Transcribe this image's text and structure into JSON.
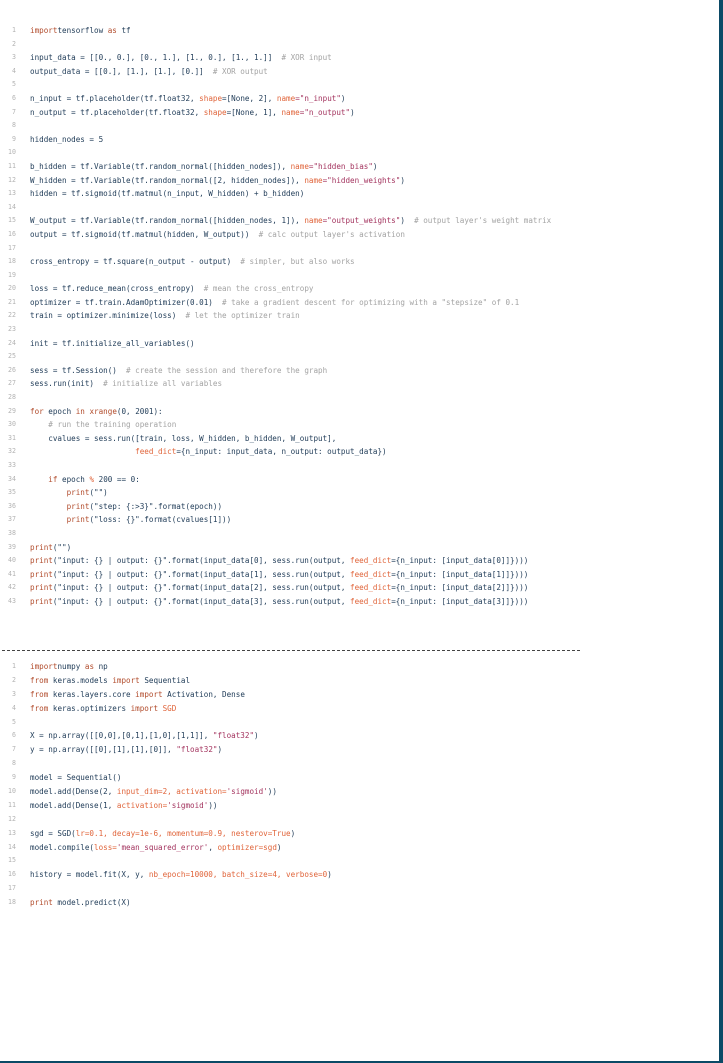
{
  "snippet_tensorflow": {
    "lines": [
      {
        "n": "1",
        "t": [
          [
            "kw",
            "import"
          ],
          [
            "",
            "tensorflow "
          ],
          [
            "kw",
            "as"
          ],
          [
            "",
            " tf"
          ]
        ]
      },
      {
        "n": "2",
        "t": []
      },
      {
        "n": "3",
        "t": [
          [
            "",
            "input_data = [[0., 0.], [0., 1.], [1., 0.], [1., 1.]]  "
          ],
          [
            "com",
            "# XOR input"
          ]
        ]
      },
      {
        "n": "4",
        "t": [
          [
            "",
            "output_data = [[0.], [1.], [1.], [0.]]  "
          ],
          [
            "com",
            "# XOR output"
          ]
        ]
      },
      {
        "n": "5",
        "t": []
      },
      {
        "n": "6",
        "t": [
          [
            "",
            "n_input = tf.placeholder(tf.float32, "
          ],
          [
            "prm",
            "shape"
          ],
          [
            "",
            "=[None, 2], "
          ],
          [
            "prm",
            "name"
          ],
          [
            "str",
            "=\"n_input\""
          ],
          [
            "",
            ")"
          ]
        ]
      },
      {
        "n": "7",
        "t": [
          [
            "",
            "n_output = tf.placeholder(tf.float32, "
          ],
          [
            "prm",
            "shape"
          ],
          [
            "",
            "=[None, 1], "
          ],
          [
            "prm",
            "name"
          ],
          [
            "str",
            "=\"n_output\""
          ],
          [
            "",
            ")"
          ]
        ]
      },
      {
        "n": "8",
        "t": []
      },
      {
        "n": "9",
        "t": [
          [
            "",
            "hidden_nodes = 5"
          ]
        ]
      },
      {
        "n": "10",
        "t": []
      },
      {
        "n": "11",
        "t": [
          [
            "",
            "b_hidden = tf.Variable(tf.random_normal([hidden_nodes]), "
          ],
          [
            "prm",
            "name"
          ],
          [
            "str",
            "=\"hidden_bias\""
          ],
          [
            "",
            ")"
          ]
        ]
      },
      {
        "n": "12",
        "t": [
          [
            "",
            "W_hidden = tf.Variable(tf.random_normal([2, hidden_nodes]), "
          ],
          [
            "prm",
            "name"
          ],
          [
            "str",
            "=\"hidden_weights\""
          ],
          [
            "",
            ")"
          ]
        ]
      },
      {
        "n": "13",
        "t": [
          [
            "",
            "hidden = tf.sigmoid(tf.matmul(n_input, W_hidden) + b_hidden)"
          ]
        ]
      },
      {
        "n": "14",
        "t": []
      },
      {
        "n": "15",
        "t": [
          [
            "",
            "W_output = tf.Variable(tf.random_normal([hidden_nodes, 1]), "
          ],
          [
            "prm",
            "name"
          ],
          [
            "str",
            "=\"output_weights\""
          ],
          [
            "",
            ")  "
          ],
          [
            "com",
            "# output layer's weight matrix"
          ]
        ]
      },
      {
        "n": "16",
        "t": [
          [
            "",
            "output = tf.sigmoid(tf.matmul(hidden, W_output))  "
          ],
          [
            "com",
            "# calc output layer's activation"
          ]
        ]
      },
      {
        "n": "17",
        "t": []
      },
      {
        "n": "18",
        "t": [
          [
            "",
            "cross_entropy = tf.square(n_output - output)  "
          ],
          [
            "com",
            "# simpler, but also works"
          ]
        ]
      },
      {
        "n": "19",
        "t": []
      },
      {
        "n": "20",
        "t": [
          [
            "",
            "loss = tf.reduce_mean(cross_entropy)  "
          ],
          [
            "com",
            "# mean the cross_entropy"
          ]
        ]
      },
      {
        "n": "21",
        "t": [
          [
            "",
            "optimizer = tf.train.AdamOptimizer(0.01)  "
          ],
          [
            "com",
            "# take a gradient descent for optimizing with a \"stepsize\" of 0.1"
          ]
        ]
      },
      {
        "n": "22",
        "t": [
          [
            "",
            "train = optimizer.minimize(loss)  "
          ],
          [
            "com",
            "# let the optimizer train"
          ]
        ]
      },
      {
        "n": "23",
        "t": []
      },
      {
        "n": "24",
        "t": [
          [
            "",
            "init = tf.initialize_all_variables()"
          ]
        ]
      },
      {
        "n": "25",
        "t": []
      },
      {
        "n": "26",
        "t": [
          [
            "",
            "sess = tf.Session()  "
          ],
          [
            "com",
            "# create the session and therefore the graph"
          ]
        ]
      },
      {
        "n": "27",
        "t": [
          [
            "",
            "sess.run(init)  "
          ],
          [
            "com",
            "# initialize all variables"
          ]
        ]
      },
      {
        "n": "28",
        "t": []
      },
      {
        "n": "29",
        "t": [
          [
            "kw",
            "for"
          ],
          [
            "",
            " epoch "
          ],
          [
            "kw",
            "in"
          ],
          [
            "",
            " "
          ],
          [
            "bi",
            "xrange"
          ],
          [
            "",
            "(0, 2001):"
          ]
        ]
      },
      {
        "n": "30",
        "t": [
          [
            "",
            "    "
          ],
          [
            "com",
            "# run the training operation"
          ]
        ]
      },
      {
        "n": "31",
        "t": [
          [
            "",
            "    cvalues = sess.run([train, loss, W_hidden, b_hidden, W_output],"
          ]
        ]
      },
      {
        "n": "32",
        "t": [
          [
            "",
            "                       "
          ],
          [
            "prm",
            "feed_dict"
          ],
          [
            "",
            "={n_input: input_data, n_output: output_data})"
          ]
        ]
      },
      {
        "n": "33",
        "t": []
      },
      {
        "n": "34",
        "t": [
          [
            "",
            "    "
          ],
          [
            "kw",
            "if"
          ],
          [
            "",
            " epoch "
          ],
          [
            "prm",
            "%"
          ],
          [
            "",
            " 200 == 0:"
          ]
        ]
      },
      {
        "n": "35",
        "t": [
          [
            "",
            "        "
          ],
          [
            "bi",
            "print"
          ],
          [
            "",
            "(\"\")"
          ]
        ]
      },
      {
        "n": "36",
        "t": [
          [
            "",
            "        "
          ],
          [
            "bi",
            "print"
          ],
          [
            "",
            "(\"step: {:>3}\".format(epoch))"
          ]
        ]
      },
      {
        "n": "37",
        "t": [
          [
            "",
            "        "
          ],
          [
            "bi",
            "print"
          ],
          [
            "",
            "(\"loss: {}\".format(cvalues[1]))"
          ]
        ]
      },
      {
        "n": "38",
        "t": []
      },
      {
        "n": "39",
        "t": [
          [
            "bi",
            "print"
          ],
          [
            "",
            "(\"\")"
          ]
        ]
      },
      {
        "n": "40",
        "t": [
          [
            "bi",
            "print"
          ],
          [
            "",
            "(\"input: {} | output: {}\".format(input_data[0], sess.run(output, "
          ],
          [
            "prm",
            "feed_dict"
          ],
          [
            "",
            "={n_input: [input_data[0]]})))"
          ]
        ]
      },
      {
        "n": "41",
        "t": [
          [
            "bi",
            "print"
          ],
          [
            "",
            "(\"input: {} | output: {}\".format(input_data[1], sess.run(output, "
          ],
          [
            "prm",
            "feed_dict"
          ],
          [
            "",
            "={n_input: [input_data[1]]})))"
          ]
        ]
      },
      {
        "n": "42",
        "t": [
          [
            "bi",
            "print"
          ],
          [
            "",
            "(\"input: {} | output: {}\".format(input_data[2], sess.run(output, "
          ],
          [
            "prm",
            "feed_dict"
          ],
          [
            "",
            "={n_input: [input_data[2]]})))"
          ]
        ]
      },
      {
        "n": "43",
        "t": [
          [
            "bi",
            "print"
          ],
          [
            "",
            "(\"input: {} | output: {}\".format(input_data[3], sess.run(output, "
          ],
          [
            "prm",
            "feed_dict"
          ],
          [
            "",
            "={n_input: [input_data[3]]})))"
          ]
        ]
      }
    ]
  },
  "snippet_keras": {
    "lines": [
      {
        "n": "1",
        "t": [
          [
            "kw",
            "import"
          ],
          [
            "",
            "numpy "
          ],
          [
            "kw",
            "as"
          ],
          [
            "",
            " np"
          ]
        ]
      },
      {
        "n": "2",
        "t": [
          [
            "kw",
            "from"
          ],
          [
            "",
            " keras.models "
          ],
          [
            "kw",
            "import"
          ],
          [
            "",
            " Sequential"
          ]
        ]
      },
      {
        "n": "3",
        "t": [
          [
            "kw",
            "from"
          ],
          [
            "",
            " keras.layers.core "
          ],
          [
            "kw",
            "import"
          ],
          [
            "",
            " Activation, Dense"
          ]
        ]
      },
      {
        "n": "4",
        "t": [
          [
            "kw",
            "from"
          ],
          [
            "",
            " keras.optimizers "
          ],
          [
            "kw",
            "import"
          ],
          [
            "",
            " "
          ],
          [
            "prm",
            "SGD"
          ]
        ]
      },
      {
        "n": "5",
        "t": []
      },
      {
        "n": "6",
        "t": [
          [
            "",
            "X = np.array([[0,0],[0,1],[1,0],[1,1]], "
          ],
          [
            "str",
            "\"float32\""
          ],
          [
            "",
            ")"
          ]
        ]
      },
      {
        "n": "7",
        "t": [
          [
            "",
            "y = np.array([[0],[1],[1],[0]], "
          ],
          [
            "str",
            "\"float32\""
          ],
          [
            "",
            ")"
          ]
        ]
      },
      {
        "n": "8",
        "t": []
      },
      {
        "n": "9",
        "t": [
          [
            "",
            "model = Sequential()"
          ]
        ]
      },
      {
        "n": "10",
        "t": [
          [
            "",
            "model.add(Dense(2, "
          ],
          [
            "prm",
            "input_dim=2, activation="
          ],
          [
            "str",
            "'sigmoid'"
          ],
          [
            "",
            "))"
          ]
        ]
      },
      {
        "n": "11",
        "t": [
          [
            "",
            "model.add(Dense(1, "
          ],
          [
            "prm",
            "activation="
          ],
          [
            "str",
            "'sigmoid'"
          ],
          [
            "",
            "))"
          ]
        ]
      },
      {
        "n": "12",
        "t": []
      },
      {
        "n": "13",
        "t": [
          [
            "",
            "sgd = SGD("
          ],
          [
            "prm",
            "lr=0.1, decay=1e-6, momentum=0.9, nesterov=True"
          ],
          [
            "",
            ")"
          ]
        ]
      },
      {
        "n": "14",
        "t": [
          [
            "",
            "model.compile("
          ],
          [
            "prm",
            "loss="
          ],
          [
            "str",
            "'mean_squared_error'"
          ],
          [
            "",
            ", "
          ],
          [
            "prm",
            "optimizer=sgd"
          ],
          [
            "",
            ")"
          ]
        ]
      },
      {
        "n": "15",
        "t": []
      },
      {
        "n": "16",
        "t": [
          [
            "",
            "history = model.fit(X, y, "
          ],
          [
            "prm",
            "nb_epoch=10000, batch_size=4, verbose=0"
          ],
          [
            "",
            ")"
          ]
        ]
      },
      {
        "n": "17",
        "t": []
      },
      {
        "n": "18",
        "t": [
          [
            "kw",
            "print"
          ],
          [
            "",
            " model.predict(X)"
          ]
        ]
      }
    ]
  },
  "colors": {
    "keyword": "#b14b2b",
    "parameter": "#e0643a",
    "string": "#a3335e",
    "comment": "#a3a3a3",
    "text": "#1f3b57",
    "line_number": "#b3b3b3",
    "frame_border": "#0b4a66"
  }
}
